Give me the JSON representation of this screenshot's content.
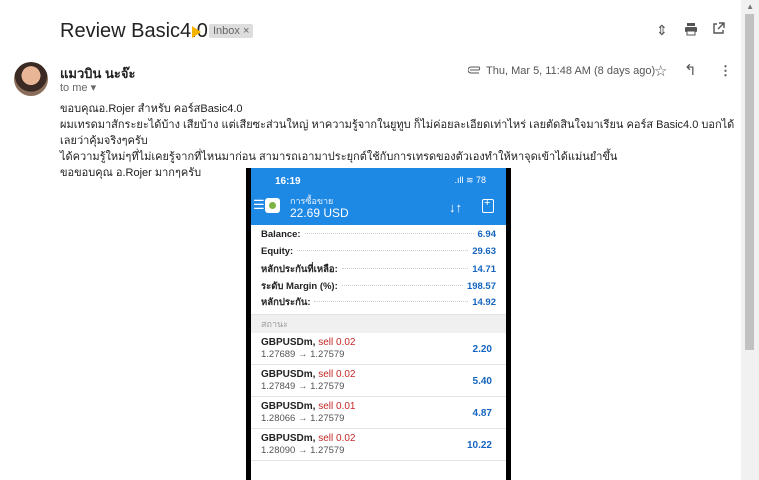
{
  "email": {
    "subject": "Review Basic4.0",
    "label_chip": "Inbox ×",
    "sender": "แมวบิน นะจ๊ะ",
    "to_me": "to me ▾",
    "date": "Thu, Mar 5, 11:48 AM (8 days ago)",
    "body_lines": [
      "ขอบคุณอ.Rojer สำหรับ คอร์สBasic4.0",
      "ผมเทรดมาสักระยะได้บ้าง เสียบ้าง แต่เสียซะส่วนใหญ่ หาความรู้จากในยูทูบ ก็ไม่ค่อยละเอียดเท่าไหร่ เลยตัดสินใจมาเรียน คอร์ส Basic4.0 บอกได้เลยว่าคุ้มจริงๆครับ",
      "ได้ความรู้ใหม่ๆที่ไม่เคยรู้จากที่ไหนมาก่อน  สามารถเอามาประยุกต์ใช้กับการเทรดของตัวเองทำให้หาจุดเข้าได้แม่นยำขึ้น",
      "ขอขอบคุณ อ.Rojer มากๆครับ"
    ]
  },
  "phone": {
    "time": "16:19",
    "status_icons": ".ıll ≋ 78",
    "account_title": "การซื้อขาย",
    "account_value": "22.69 USD",
    "stats": [
      {
        "label": "Balance:",
        "value": "6.94"
      },
      {
        "label": "Equity:",
        "value": "29.63"
      },
      {
        "label": "หลักประกันที่เหลือ:",
        "value": "14.71"
      },
      {
        "label": "ระดับ Margin (%):",
        "value": "198.57"
      },
      {
        "label": "หลักประกัน:",
        "value": "14.92"
      }
    ],
    "section_label": "สถานะ",
    "positions": [
      {
        "symbol": "GBPUSDm,",
        "side": "sell 0.02",
        "prices": "1.27689 → 1.27579",
        "profit": "2.20"
      },
      {
        "symbol": "GBPUSDm,",
        "side": "sell 0.02",
        "prices": "1.27849 → 1.27579",
        "profit": "5.40"
      },
      {
        "symbol": "GBPUSDm,",
        "side": "sell 0.01",
        "prices": "1.28066 → 1.27579",
        "profit": "4.87"
      },
      {
        "symbol": "GBPUSDm,",
        "side": "sell 0.02",
        "prices": "1.28090 → 1.27579",
        "profit": "10.22"
      }
    ]
  },
  "icons": {
    "collapse": "expand-collapse-icon",
    "print": "print-icon",
    "open_new": "open-new-window-icon",
    "attachment": "attachment-icon",
    "star": "star-icon",
    "reply": "reply-icon",
    "more": "more-vertical-icon"
  },
  "colors": {
    "accent_blue": "#1e88e5",
    "label_yellow": "#f4b400",
    "sell_red": "#c62828"
  }
}
